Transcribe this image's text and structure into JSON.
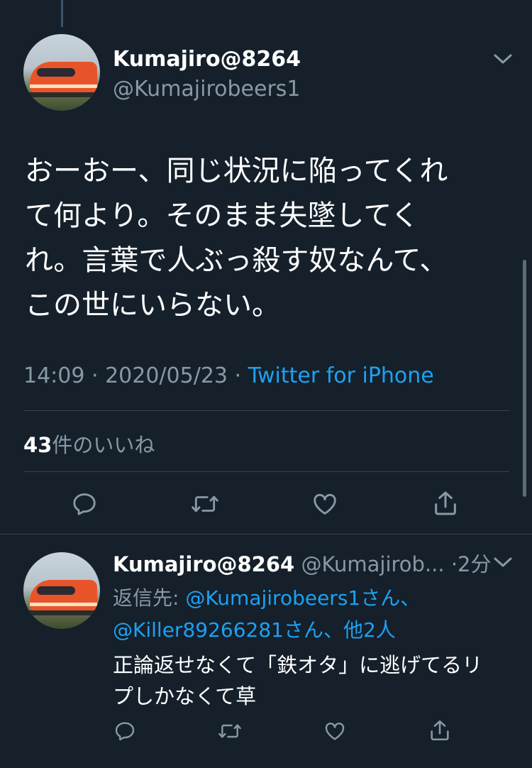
{
  "main_tweet": {
    "display_name": "Kumajiro@8264",
    "handle": "@Kumajirobeers1",
    "text_lines": [
      "おーおー、同じ状況に陥ってくれ",
      "て何より。そのまま失墜してく",
      "れ。言葉で人ぶっ殺す奴なんて、",
      "この世にいらない。"
    ],
    "time": "14:09",
    "date": "2020/05/23",
    "separator": " · ",
    "source": "Twitter for iPhone",
    "likes_count": "43",
    "likes_label": "件のいいね"
  },
  "reply_tweet": {
    "display_name": "Kumajiro@8264",
    "handle": "@Kumajirob...",
    "time_ago": "·2分",
    "reply_prefix": "返信先: ",
    "reply_mention_1": "@Kumajirobeers1",
    "reply_suffix_1": "さん、",
    "reply_mention_2": "@Killer89266281",
    "reply_suffix_2": "さん、他2人",
    "text_lines": [
      "正論返せなくて「鉄オタ」に逃げてるリ",
      "プしかなくて草"
    ]
  },
  "icons": {
    "more": "chevron-down-icon",
    "reply": "reply-icon",
    "retweet": "retweet-icon",
    "like": "heart-icon",
    "share": "share-icon"
  },
  "colors": {
    "background": "#15202b",
    "link": "#1da1f2",
    "muted": "#8899a6",
    "divider": "#38444d"
  }
}
